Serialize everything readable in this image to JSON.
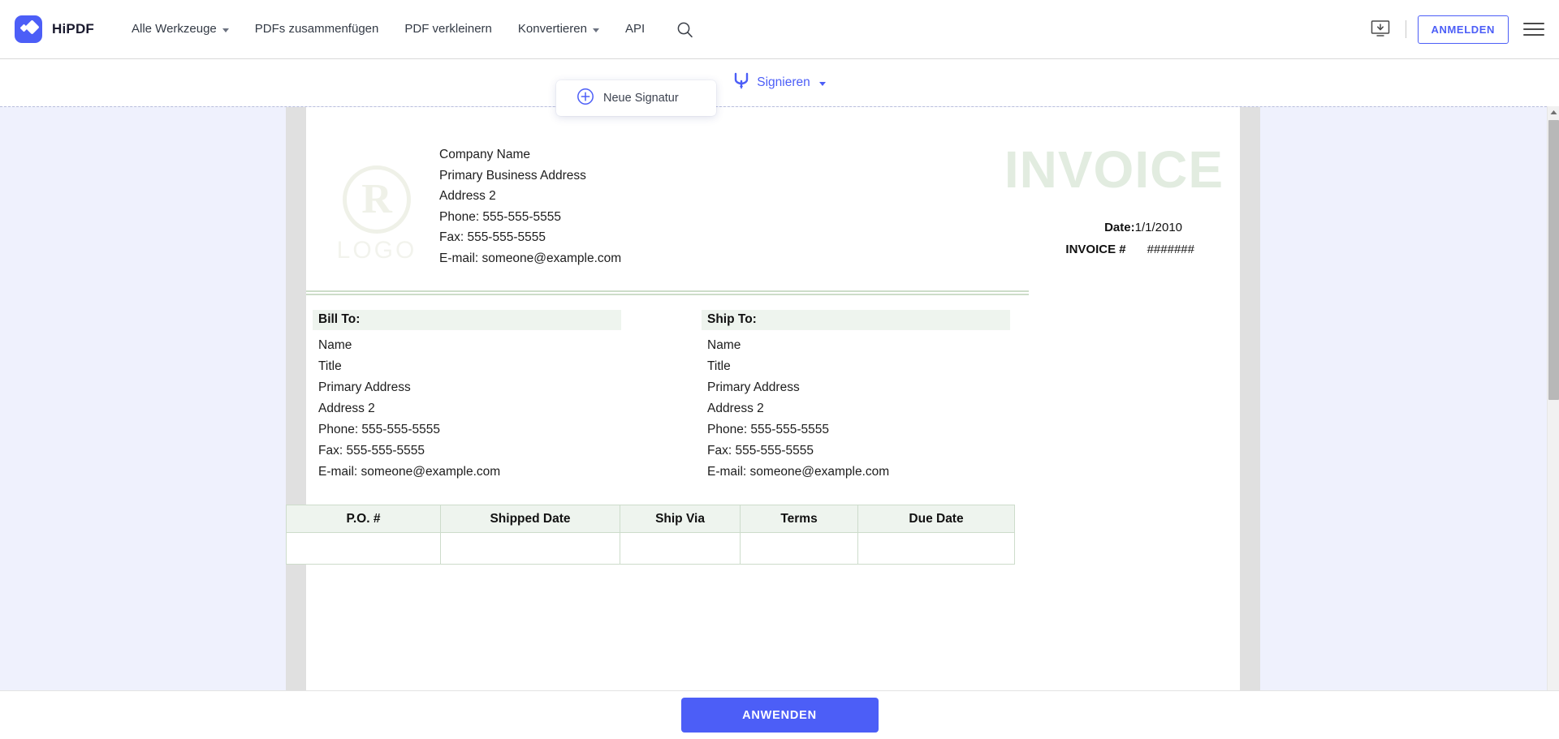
{
  "nav": {
    "brand": "HiPDF",
    "brand_logo_icon": "hipdf-diamond-logo",
    "links": [
      {
        "label": "Alle Werkzeuge",
        "has_caret": true
      },
      {
        "label": "PDFs zusammenfügen",
        "has_caret": false
      },
      {
        "label": "PDF verkleinern",
        "has_caret": false
      },
      {
        "label": "Konvertieren",
        "has_caret": true
      },
      {
        "label": "API",
        "has_caret": false
      }
    ],
    "search_icon": "search-icon",
    "download_icon": "download-to-device-icon",
    "login_label": "ANMELDEN",
    "menu_icon": "hamburger-menu-icon",
    "accent_color": "#4c5ef7"
  },
  "toolbar": {
    "sign_label": "Signieren",
    "sign_icon": "signature-pen-icon",
    "dropdown": {
      "items": [
        {
          "label": "Neue Signatur",
          "icon": "plus-circle-icon"
        }
      ]
    }
  },
  "document": {
    "logo": {
      "mark": "R",
      "word": "LOGO"
    },
    "company": [
      "Company  Name",
      "Primary Business Address",
      "Address 2",
      "Phone: 555-555-5555",
      "Fax: 555-555-5555",
      "E-mail: someone@example.com"
    ],
    "title": "INVOICE",
    "title_color": "#e2ece0",
    "date_label": "Date:",
    "date_value": "1/1/2010",
    "invoice_num_label": "INVOICE #",
    "invoice_num_value": "#######",
    "bill_to": {
      "heading": "Bill To:",
      "lines": [
        "Name",
        "Title",
        "Primary Address",
        "Address 2",
        "Phone: 555-555-5555",
        "Fax: 555-555-5555",
        "E-mail: someone@example.com"
      ]
    },
    "ship_to": {
      "heading": "Ship To:",
      "lines": [
        "Name",
        "Title",
        "Primary Address",
        "Address 2",
        "Phone: 555-555-5555",
        "Fax: 555-555-5555",
        "E-mail: someone@example.com"
      ]
    },
    "table": {
      "headers": [
        "P.O. #",
        "Shipped Date",
        "Ship Via",
        "Terms",
        "Due Date"
      ],
      "rows": [
        [
          "",
          "",
          "",
          "",
          ""
        ]
      ]
    }
  },
  "footer": {
    "apply_label": "ANWENDEN"
  }
}
